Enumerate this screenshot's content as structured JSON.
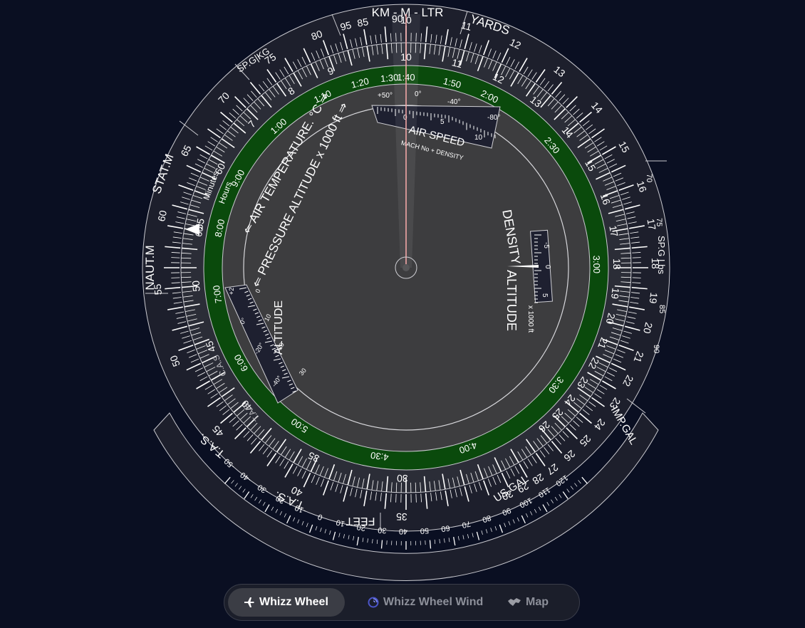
{
  "tabs": [
    {
      "label": "Whizz Wheel",
      "icon": "airplane-icon",
      "active": true
    },
    {
      "label": "Whizz Wheel Wind",
      "icon": "wind-swirl-icon",
      "active": false
    },
    {
      "label": "Map",
      "icon": "map-icon",
      "active": false
    }
  ],
  "outer_scale": {
    "labels": [
      "KM - M - LTR",
      "YARDS",
      "SP.G|KG",
      "STAT.M",
      "NAUT.M",
      "SP.G Lbs",
      "IMP.GAL",
      "US.GAL",
      "FEET"
    ],
    "side_marks": [
      "70",
      "75",
      "85",
      "90"
    ],
    "numbers": [
      "10",
      "11",
      "12",
      "13",
      "14",
      "15",
      "16",
      "17",
      "18",
      "19",
      "20",
      "21",
      "22",
      "23",
      "24",
      "25",
      "26",
      "27",
      "28",
      "29",
      "30",
      "35",
      "40",
      "45",
      "50",
      "55",
      "60",
      "65",
      "70",
      "75",
      "80",
      "85",
      "90",
      "95"
    ]
  },
  "inner_scale": {
    "numbers": [
      "10",
      "11",
      "12",
      "13",
      "14",
      "15",
      "16",
      "17",
      "18",
      "19",
      "20",
      "21",
      "22",
      "23",
      "24",
      "25",
      "26",
      "30",
      "35",
      "40",
      "45",
      "50",
      "55",
      "60",
      "7",
      "8",
      "9"
    ],
    "labels": [
      "Minutes",
      "Hours",
      "C.A.S",
      "T.A.S",
      "60"
    ]
  },
  "time_ring": {
    "labels": [
      "1:40",
      "1:50",
      "2:00",
      "2:30",
      "3:00",
      "3:30",
      "4:00",
      "4:30",
      "5:00",
      "6:00",
      "7:00",
      "8:00",
      "9:00",
      "1:00",
      "1:10",
      "1:20",
      "1:30"
    ]
  },
  "disc": {
    "air_temp_label": "⇐ AIR TEMPERATURE. °C ⇒",
    "pressure_alt_label": "⇐ PRESSURE ALTITUDE x 1000 ft ⇒",
    "density_label": "DENSITY",
    "altitude_label": "ALTITUDE",
    "altitude_window_label": "ALTITUDE",
    "x1000ft_label": "x 1000 ft",
    "airspeed_window": {
      "title": "AIR SPEED",
      "subtitle": "MACH No + DENSITY",
      "temps": [
        "+50°",
        "0°",
        "-40°",
        "-80°"
      ],
      "nums": [
        "0",
        "5",
        "10"
      ]
    },
    "density_window_nums": [
      "-5",
      "0",
      "5"
    ],
    "altitude_window_nums": [
      "+2",
      "0",
      "10",
      "0°",
      "20",
      "-20°",
      "30",
      "-40°"
    ]
  },
  "tas_scale": {
    "labels": [
      "T.A.S.",
      "T.A.S."
    ],
    "numbers": [
      "-50",
      "-40",
      "-30",
      "-20",
      "-10",
      "0",
      "10",
      "20",
      "30",
      "40",
      "50",
      "60",
      "70",
      "80",
      "90",
      "100",
      "110",
      "120"
    ]
  },
  "colors": {
    "background": "#0a0f22",
    "outer_ring": "#1d1f2c",
    "mid_ring": "#2b2d37",
    "green_ring": "#0a4a0c",
    "disc": "#3d3d3f",
    "cursor_line": "#f2a6a6"
  }
}
